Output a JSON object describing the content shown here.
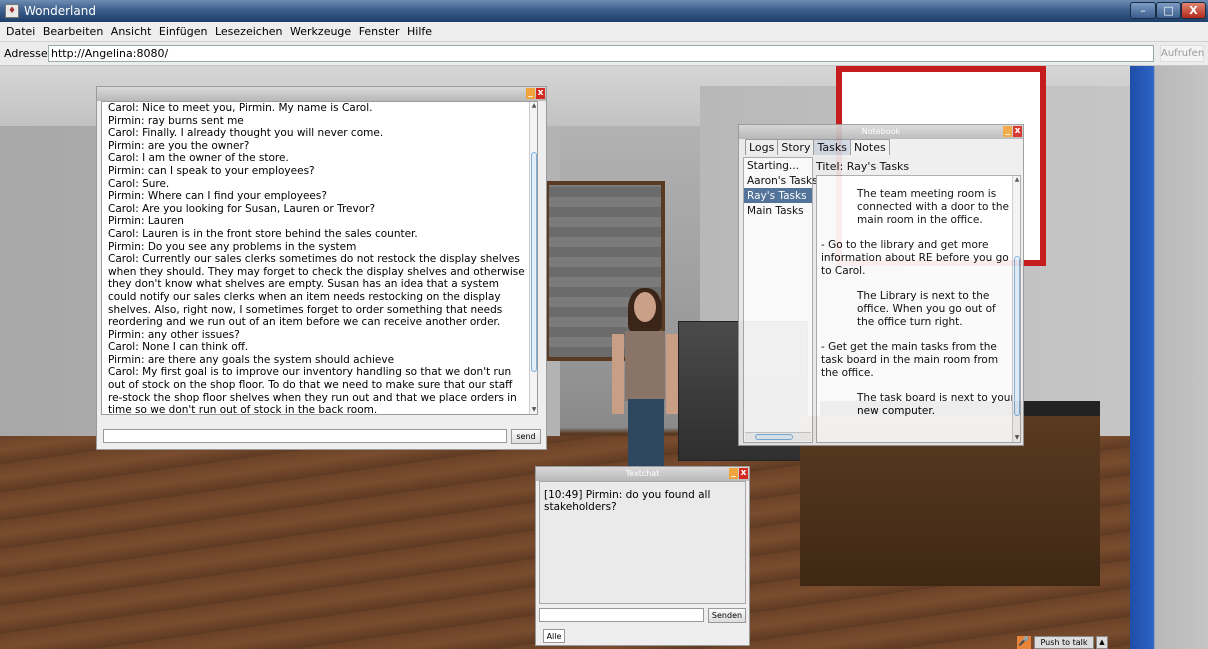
{
  "window": {
    "title": "Wonderland",
    "minimize": "–",
    "maximize": "□",
    "close": "X"
  },
  "menu": [
    "Datei",
    "Bearbeiten",
    "Ansicht",
    "Einfügen",
    "Lesezeichen",
    "Werkzeuge",
    "Fenster",
    "Hilfe"
  ],
  "address": {
    "label": "Adresse:",
    "value": "http://Angelina:8080/",
    "go": "Aufrufen"
  },
  "chat_window": {
    "lines": [
      "Carol: Nice to meet you, Pirmin. My name is Carol.",
      "Pirmin: ray burns sent me",
      "Carol: Finally. I already thought you will never come.",
      "Pirmin: are you the owner?",
      "Carol: I am the owner of the store.",
      "Pirmin: can I speak to your employees?",
      "Carol: Sure.",
      "Pirmin: Where can I find your employees?",
      "Carol: Are you looking for Susan, Lauren or Trevor?",
      "Pirmin: Lauren",
      "Carol: Lauren is in the front store behind the sales counter.",
      "Pirmin: Do you see any problems in the system",
      "Carol: Currently our sales clerks sometimes do not restock the display shelves when they should. They may forget to check the display shelves and otherwise they don't know what shelves are empty.  Susan has an idea that a system could notify our sales clerks when an item needs restocking on the display shelves. Also, right now, I sometimes forget to order something that needs reordering and we run out of an item before we can receive another order.",
      "Pirmin: any other issues?",
      "Carol: None I can think off.",
      "Pirmin: are there any goals the system should achieve",
      "Carol: My first goal is to improve our inventory handling so that we don't run out of stock on the shop floor. To do that we need to make sure that our staff re-stock the shop floor shelves when they run out and that we place orders in time so we don't run out of stock in the back room."
    ],
    "send": "send"
  },
  "notebook": {
    "title": "Notebook",
    "tabs": [
      "Logs",
      "Story",
      "Tasks",
      "Notes"
    ],
    "active_tab": "Tasks",
    "list": [
      "Starting...",
      "Aaron's Tasks",
      "Ray's Tasks",
      "Main Tasks"
    ],
    "selected": "Ray's Tasks",
    "titel": "Titel: Ray's Tasks",
    "content": {
      "p1": "The team meeting room is connected with a door to the main room in the office.",
      "p2": "- Go to the library and get more information about RE before you go to Carol.",
      "p3": "The Library is next to the office. When you go out of the office turn right.",
      "p4": "- Get get the main tasks from the task board in the main room from the office.",
      "p5": "The task board is next to your new computer."
    }
  },
  "textchat": {
    "title": "Textchat",
    "message": "[10:49] Pirmin: do you found all stakeholders?",
    "send": "Senden",
    "tab": "Alle"
  },
  "push_to_talk": {
    "label": "Push to talk"
  }
}
